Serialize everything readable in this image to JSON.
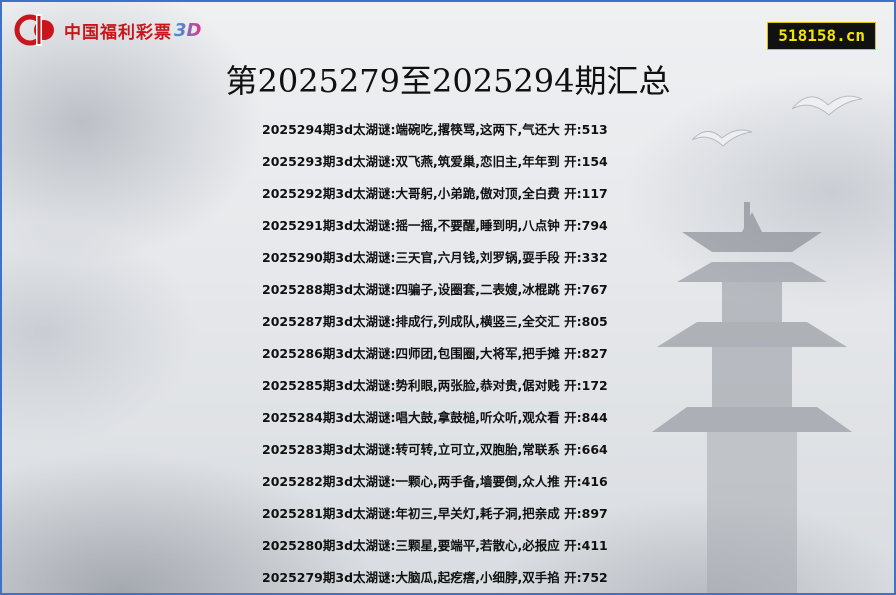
{
  "brand": {
    "logo_text": "中国福利彩票",
    "logo_suffix": "3D",
    "site": "518158.cn",
    "colors": {
      "brand_red": "#c8161d",
      "badge_bg": "#111111",
      "badge_text": "#f5e400",
      "border": "#3b73c8"
    }
  },
  "title": "第2025279至2025294期汇总",
  "entries": [
    "2025294期3d太湖谜:端碗吃,撂筷骂,这两下,气还大 开:513",
    "2025293期3d太湖谜:双飞燕,筑爱巢,恋旧主,年年到 开:154",
    "2025292期3d太湖谜:大哥躬,小弟跪,傲对顶,全白费 开:117",
    "2025291期3d太湖谜:摇一摇,不要醒,睡到明,八点钟 开:794",
    "2025290期3d太湖谜:三天官,六月钱,刘罗锅,耍手段 开:332",
    "2025288期3d太湖谜:四骗子,设圈套,二表嫂,冰棍跳 开:767",
    "2025287期3d太湖谜:排成行,列成队,横竖三,全交汇 开:805",
    "2025286期3d太湖谜:四师团,包围圈,大将军,把手摊 开:827",
    "2025285期3d太湖谜:势利眼,两张脸,恭对贵,倨对贱 开:172",
    "2025284期3d太湖谜:唱大鼓,拿鼓槌,听众听,观众看 开:844",
    "2025283期3d太湖谜:转可转,立可立,双胞胎,常联系 开:664",
    "2025282期3d太湖谜:一颗心,两手备,墙要倒,众人推 开:416",
    "2025281期3d太湖谜:年初三,早关灯,耗子洞,把亲成 开:897",
    "2025280期3d太湖谜:三颗星,要端平,若散心,必报应 开:411",
    "2025279期3d太湖谜:大脑瓜,起疙瘩,小细脖,双手掐 开:752"
  ]
}
